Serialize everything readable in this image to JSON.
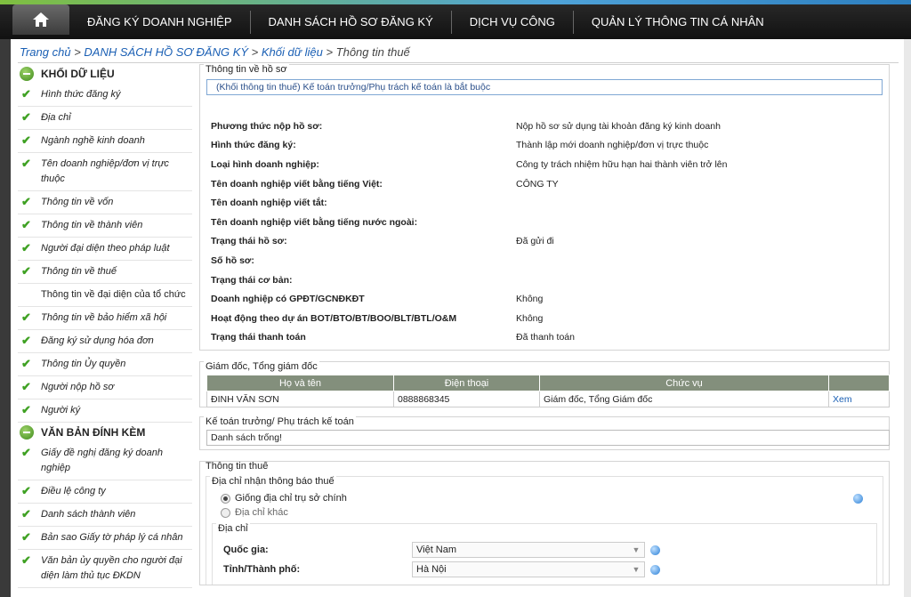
{
  "nav": {
    "items": [
      "ĐĂNG KÝ DOANH NGHIỆP",
      "DANH SÁCH HỒ SƠ ĐĂNG KÝ",
      "DỊCH VỤ CÔNG",
      "QUẢN LÝ THÔNG TIN CÁ NHÂN"
    ]
  },
  "breadcrumb": {
    "home": "Trang chủ",
    "sep": " > ",
    "list": "DANH SÁCH HỒ SƠ ĐĂNG KÝ",
    "data": "Khối dữ liệu",
    "current": "Thông tin thuế"
  },
  "sidebar": {
    "data_block_title": "KHỐI DỮ LIỆU",
    "data_items": [
      "Hình thức đăng ký",
      "Địa chỉ",
      "Ngành nghề kinh doanh",
      "Tên doanh nghiệp/đơn vị trực thuộc",
      "Thông tin về vốn",
      "Thông tin về thành viên",
      "Người đại diện theo pháp luật",
      "Thông tin về thuế",
      "Thông tin về đại diện của tổ chức",
      "Thông tin về bảo hiểm xã hội",
      "Đăng ký sử dụng hóa đơn",
      "Thông tin Ủy quyền",
      "Người nộp hồ sơ",
      "Người ký"
    ],
    "attach_title": "VĂN BẢN ĐÍNH KÈM",
    "attach_items": [
      "Giấy đề nghị đăng ký doanh nghiệp",
      "Điều lệ công ty",
      "Danh sách thành viên",
      "Bản sao Giấy tờ pháp lý cá nhân",
      "Văn bản ủy quyền cho người đại diện làm thủ tục ĐKDN"
    ]
  },
  "profile": {
    "legend": "Thông tin về hồ sơ",
    "note": "(Khối thông tin thuế) Kế toán trưởng/Phụ trách kế toán là bắt buộc",
    "rows": [
      {
        "label": "Phương thức nộp hồ sơ:",
        "value": "Nộp hồ sơ sử dụng tài khoản đăng ký kinh doanh"
      },
      {
        "label": "Hình thức đăng ký:",
        "value": "Thành lập mới doanh nghiệp/đơn vị trực thuộc"
      },
      {
        "label": "Loại hình doanh nghiệp:",
        "value": "Công ty trách nhiệm hữu hạn hai thành viên trở lên"
      },
      {
        "label": "Tên doanh nghiệp viết bằng tiếng Việt:",
        "value": "CÔNG TY"
      },
      {
        "label": "Tên doanh nghiệp viết tắt:",
        "value": ""
      },
      {
        "label": "Tên doanh nghiệp viết bằng tiếng nước ngoài:",
        "value": ""
      },
      {
        "label": "Trạng thái hồ sơ:",
        "value": "Đã gửi đi"
      },
      {
        "label": "Số hồ sơ:",
        "value": ""
      },
      {
        "label": "Trạng thái cơ bản:",
        "value": ""
      },
      {
        "label": "Doanh nghiệp có GPĐT/GCNĐKĐT",
        "value": "Không"
      },
      {
        "label": "Hoạt động theo dự án BOT/BTO/BT/BOO/BLT/BTL/O&M",
        "value": "Không"
      },
      {
        "label": "Trạng thái thanh toán",
        "value": "Đã thanh toán"
      }
    ]
  },
  "director": {
    "legend": "Giám đốc, Tổng giám đốc",
    "headers": [
      "Họ và tên",
      "Điện thoại",
      "Chức vụ",
      ""
    ],
    "rows": [
      {
        "name": "ĐINH VĂN SƠN",
        "phone": "0888868345",
        "position": "Giám đốc, Tổng Giám đốc",
        "action": "Xem"
      }
    ]
  },
  "accountant": {
    "legend": "Kế toán trưởng/ Phụ trách kế toán",
    "empty": "Danh sách trống!"
  },
  "tax": {
    "legend": "Thông tin thuế",
    "address_legend": "Địa chỉ nhận thông báo thuế",
    "option_same": "Giống địa chỉ trụ sở chính",
    "option_other": "Địa chỉ khác",
    "addr_sub_legend": "Địa chỉ",
    "country_label": "Quốc gia:",
    "country_value": "Việt Nam",
    "province_label": "Tỉnh/Thành phố:",
    "province_value": "Hà Nội"
  },
  "colors": {
    "table_header": "#838f7c",
    "link": "#1a5fb4",
    "check": "#3fa123"
  }
}
